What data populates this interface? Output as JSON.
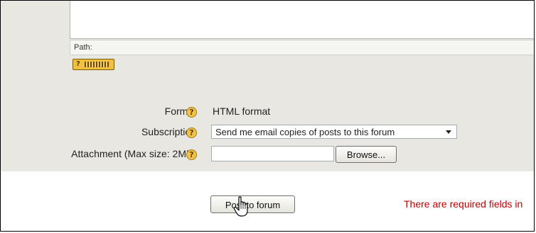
{
  "editor": {
    "path_label": "Path:",
    "keyboard_help_icon": "keyboard-help-icon"
  },
  "fields": {
    "format": {
      "label": "Format",
      "value": "HTML format"
    },
    "subscription": {
      "label": "Subscription",
      "selected": "Send me email copies of posts to this forum"
    },
    "attachment": {
      "label": "Attachment (Max size: 2MB)",
      "value": "",
      "browse_label": "Browse..."
    }
  },
  "actions": {
    "post_label": "Post to forum",
    "required_note": "There are required fields in"
  },
  "colors": {
    "panel_bg": "#e8e7e1",
    "help_icon": "#f3c24a",
    "required_text": "#c00000"
  },
  "icons": {
    "help": "question-mark-help-icon",
    "cursor": "hand-pointer-cursor"
  }
}
